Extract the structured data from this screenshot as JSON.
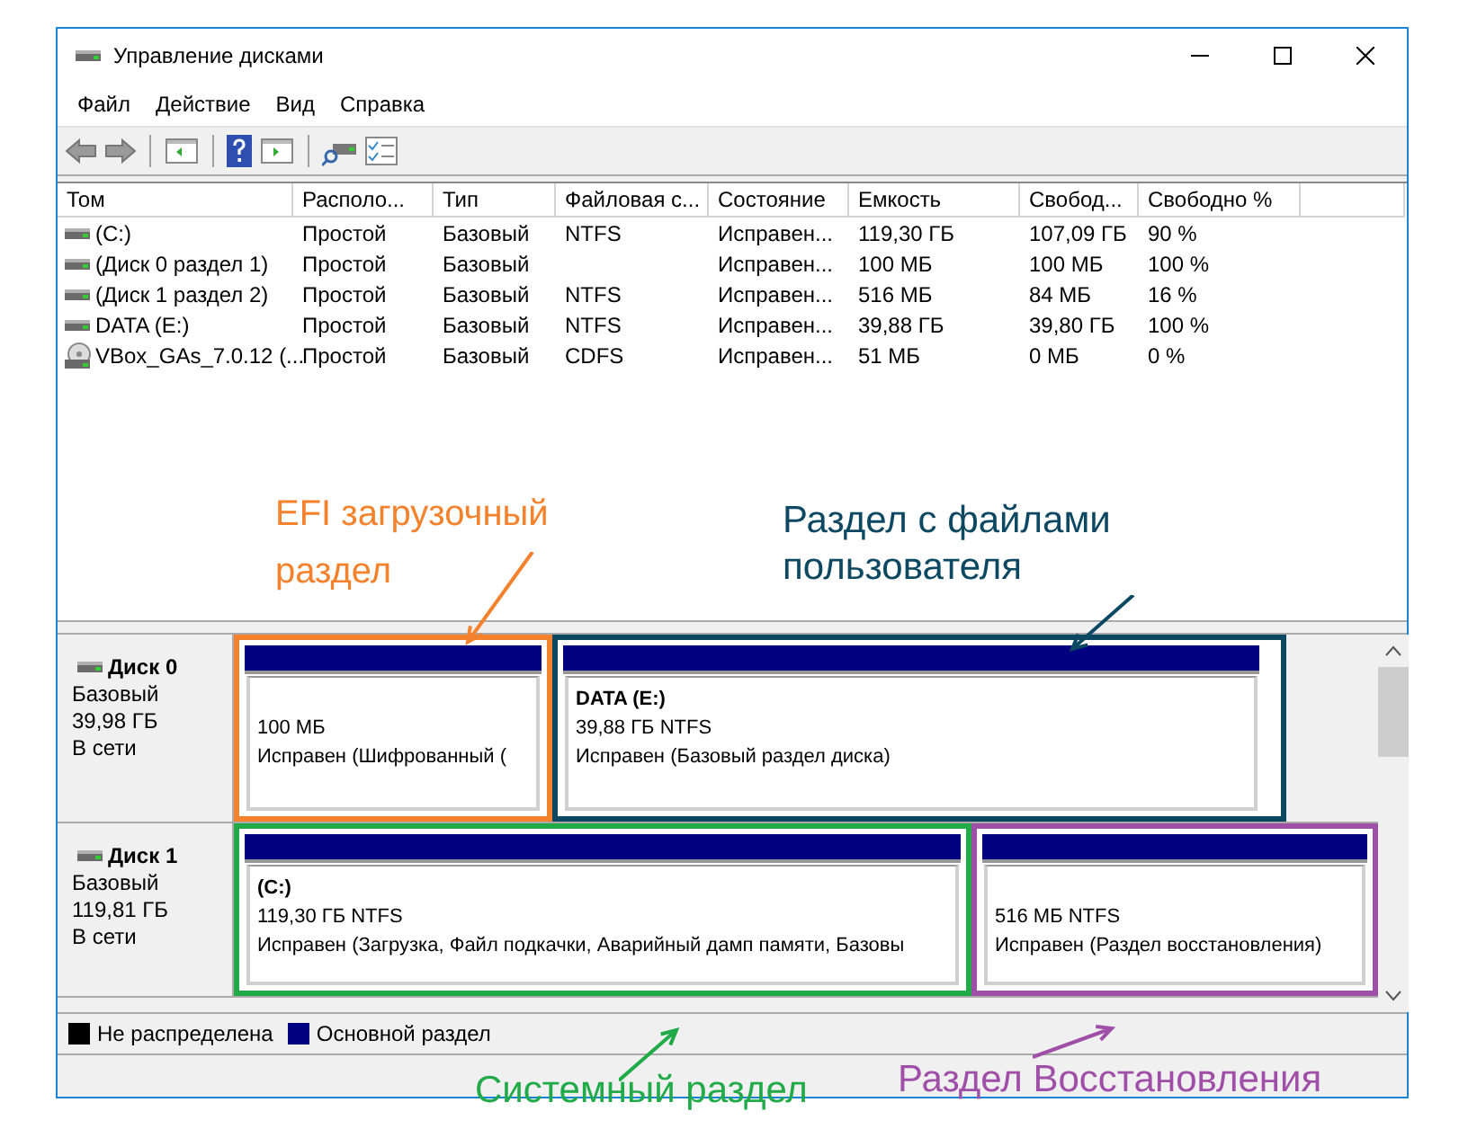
{
  "window": {
    "title": "Управление дисками"
  },
  "menu": [
    "Файл",
    "Действие",
    "Вид",
    "Справка"
  ],
  "volumes": {
    "columns": [
      "Том",
      "Располо...",
      "Тип",
      "Файловая с...",
      "Состояние",
      "Емкость",
      "Свобод...",
      "Свободно %"
    ],
    "rows": [
      {
        "kind": "disk",
        "cells": [
          " (C:)",
          "Простой",
          "Базовый",
          "NTFS",
          "Исправен...",
          "119,30 ГБ",
          "107,09 ГБ",
          "90 %"
        ]
      },
      {
        "kind": "disk",
        "cells": [
          "(Диск 0 раздел 1)",
          "Простой",
          "Базовый",
          "",
          "Исправен...",
          "100 МБ",
          "100 МБ",
          "100 %"
        ]
      },
      {
        "kind": "disk",
        "cells": [
          "(Диск 1 раздел 2)",
          "Простой",
          "Базовый",
          "NTFS",
          "Исправен...",
          "516 МБ",
          "84 МБ",
          "16 %"
        ]
      },
      {
        "kind": "disk",
        "cells": [
          "DATA (E:)",
          "Простой",
          "Базовый",
          "NTFS",
          "Исправен...",
          "39,88 ГБ",
          "39,80 ГБ",
          "100 %"
        ]
      },
      {
        "kind": "cd",
        "cells": [
          "VBox_GAs_7.0.12 (...",
          "Простой",
          "Базовый",
          "CDFS",
          "Исправен...",
          "51 МБ",
          "0 МБ",
          "0 %"
        ]
      }
    ]
  },
  "disks": [
    {
      "name": "Диск 0",
      "type": "Базовый",
      "size": "39,98 ГБ",
      "status": "В сети",
      "partitions": [
        {
          "size": "100 МБ",
          "status": "Исправен (Шифрованный (",
          "color": "#f4822c"
        },
        {
          "label": "DATA  (E:)",
          "size": "39,88 ГБ NTFS",
          "status": "Исправен (Базовый раздел диска)",
          "color": "#0d4862"
        }
      ]
    },
    {
      "name": "Диск 1",
      "type": "Базовый",
      "size": "119,81 ГБ",
      "status": "В сети",
      "partitions": [
        {
          "label": " (C:)",
          "size": "119,30 ГБ NTFS",
          "status": "Исправен (Загрузка, Файл подкачки, Аварийный дамп памяти, Базовы",
          "color": "#21aa48"
        },
        {
          "size": "516 МБ NTFS",
          "status": "Исправен (Раздел восстановления)",
          "color": "#a04fa8"
        }
      ]
    }
  ],
  "legend": [
    {
      "label": "Не распределена",
      "color": "#000000"
    },
    {
      "label": "Основной раздел",
      "color": "#000080"
    }
  ],
  "callouts": [
    {
      "text": "EFI загрузочный раздел",
      "color": "#f4822c"
    },
    {
      "text": "Раздел с файлами пользователя",
      "color": "#0d4862"
    },
    {
      "text": "Системный раздел",
      "color": "#21aa48"
    },
    {
      "text": "Раздел Восстановления",
      "color": "#a04fa8"
    }
  ]
}
